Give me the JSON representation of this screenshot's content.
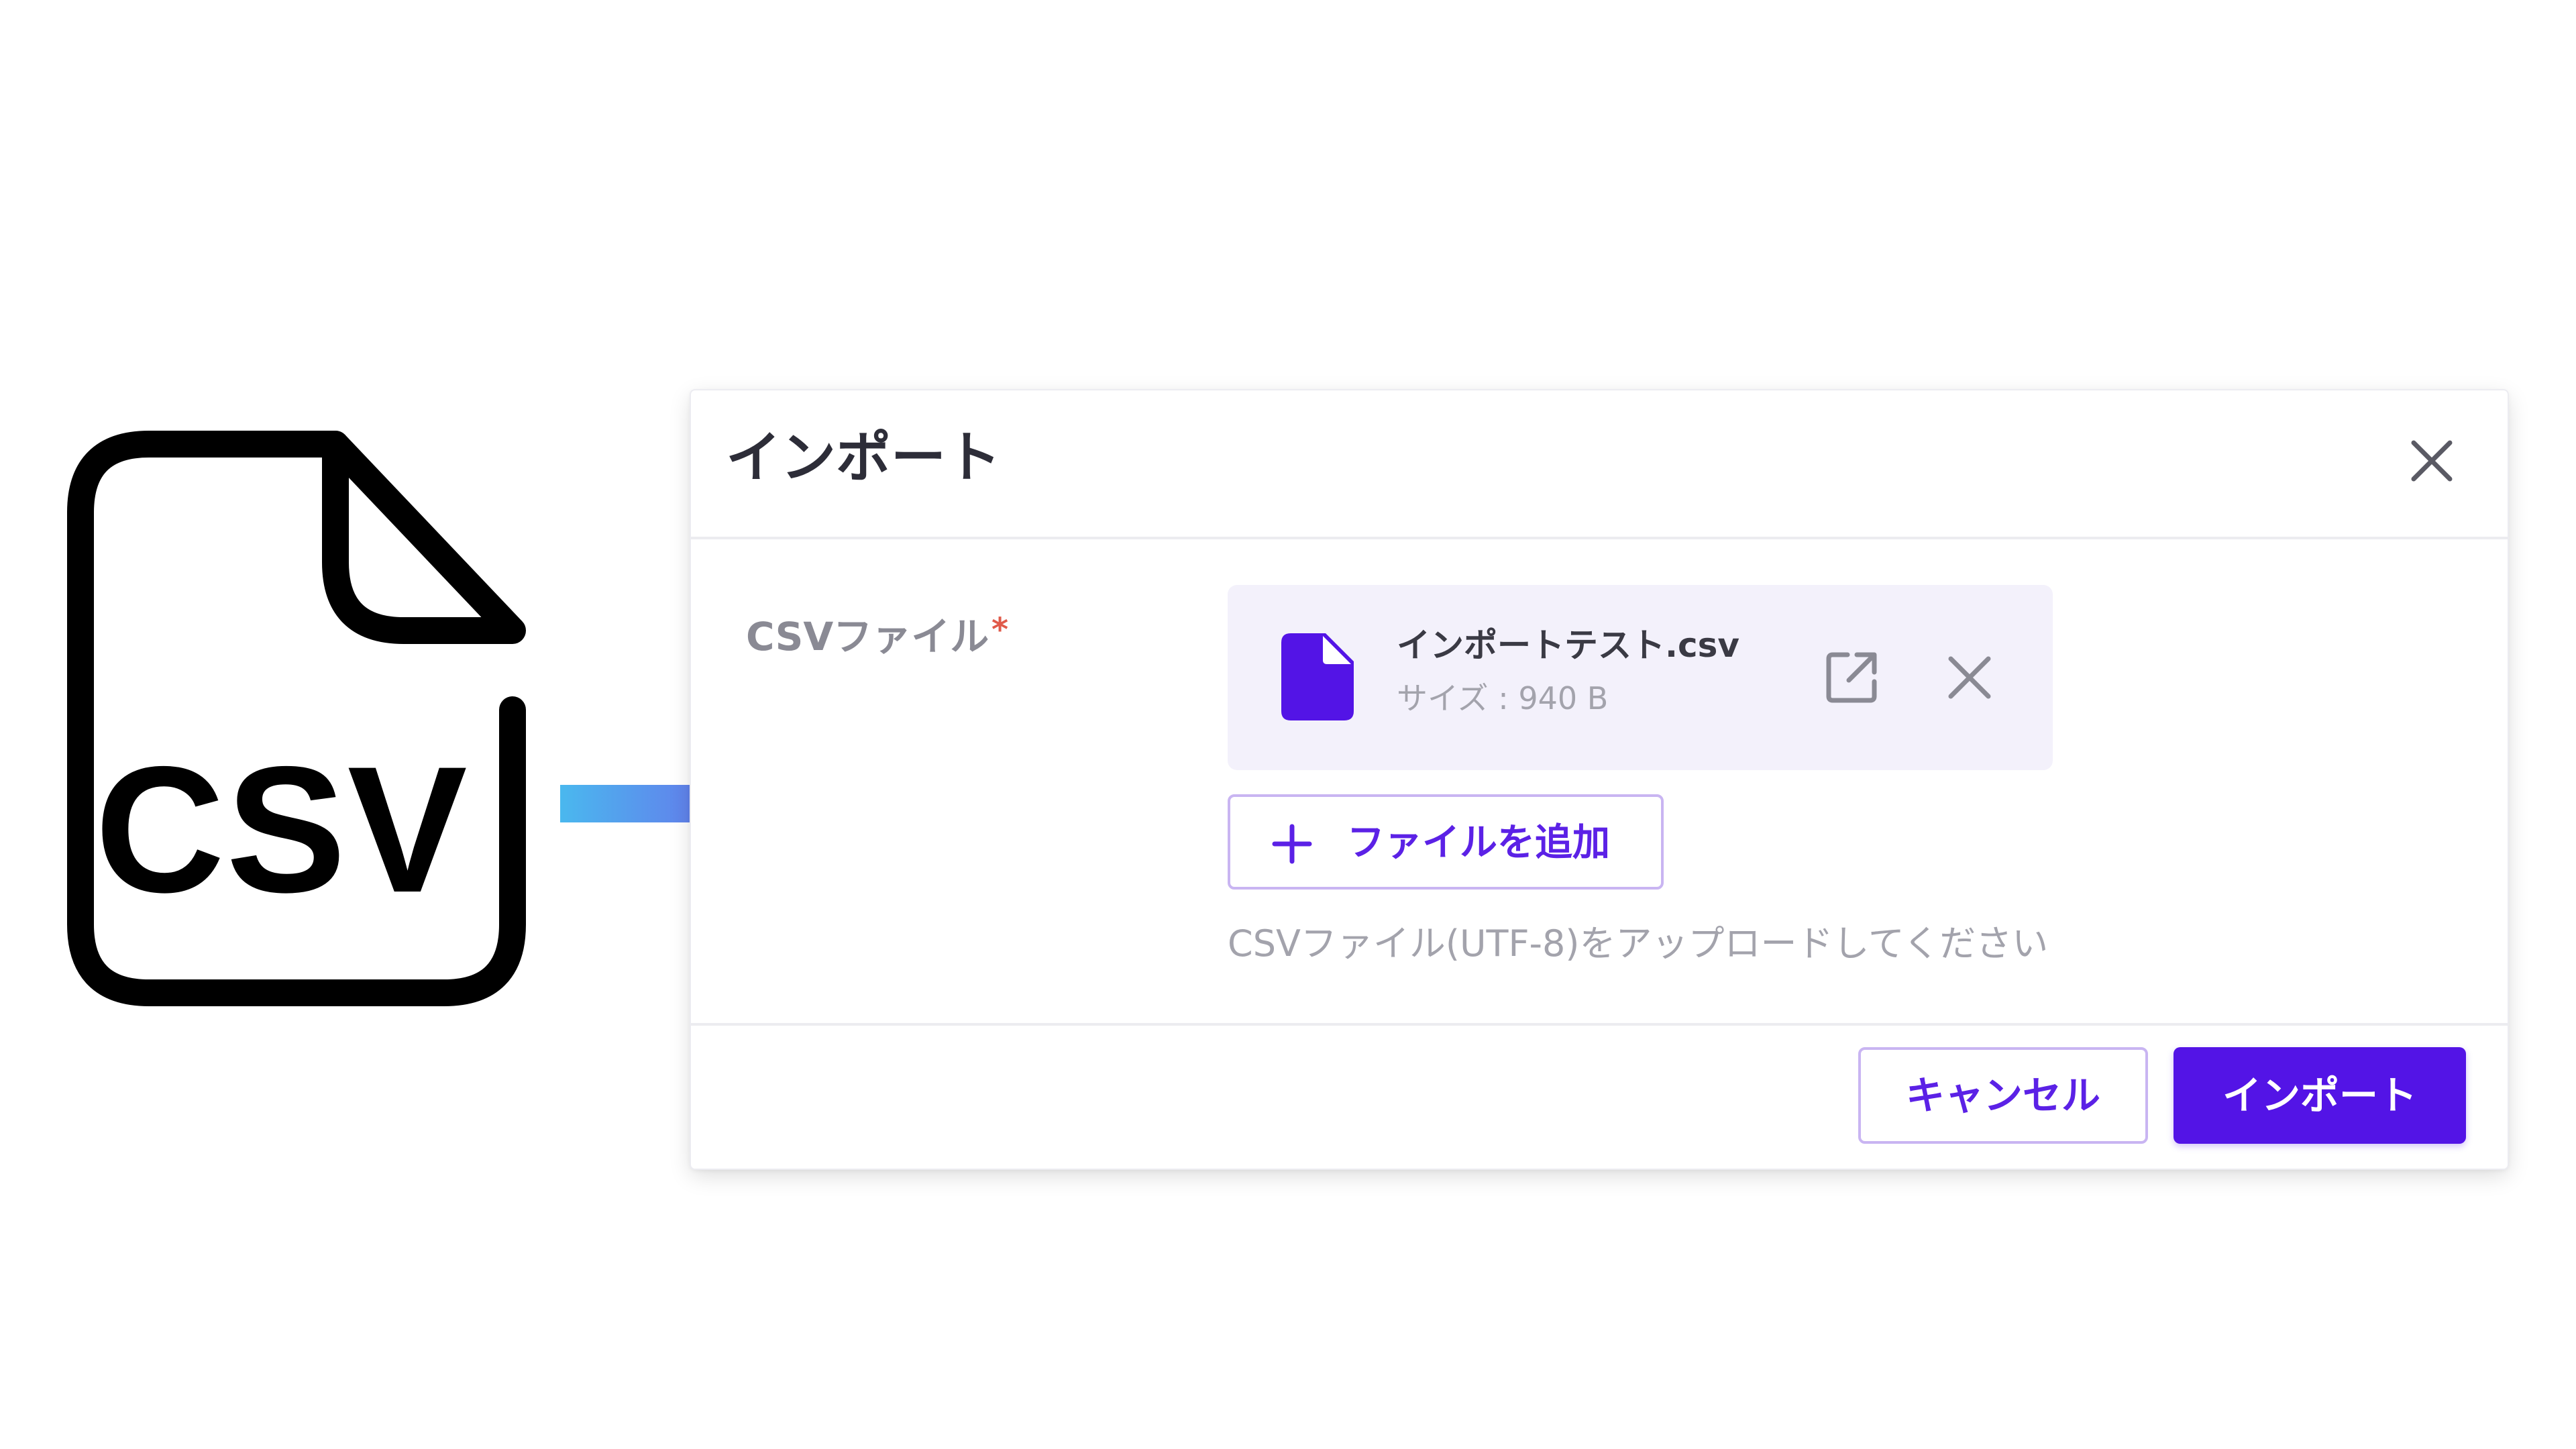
{
  "illustration": {
    "csv_label": "CSV",
    "arrow_gradient": [
      "#4ab8ee",
      "#7a48ea"
    ]
  },
  "dialog": {
    "title": "インポート",
    "close_icon": "close-icon",
    "field": {
      "label": "CSVファイル",
      "required_mark": "*"
    },
    "file": {
      "icon": "file-icon",
      "name": "インポートテスト.csv",
      "size": "サイズ : 940 B",
      "open_icon": "open-in-new-icon",
      "remove_icon": "close-icon"
    },
    "add_file": {
      "icon": "plus-icon",
      "label": "ファイルを追加"
    },
    "help_text": "CSVファイル(UTF-8)をアップロードしてください",
    "footer": {
      "cancel_label": "キャンセル",
      "import_label": "インポート"
    }
  },
  "colors": {
    "accent": "#5314e6",
    "accent_border": "#c9b5f2",
    "file_card_bg": "#f3f1fb",
    "required": "#e05a4a",
    "muted_text": "#a3a3ac"
  }
}
